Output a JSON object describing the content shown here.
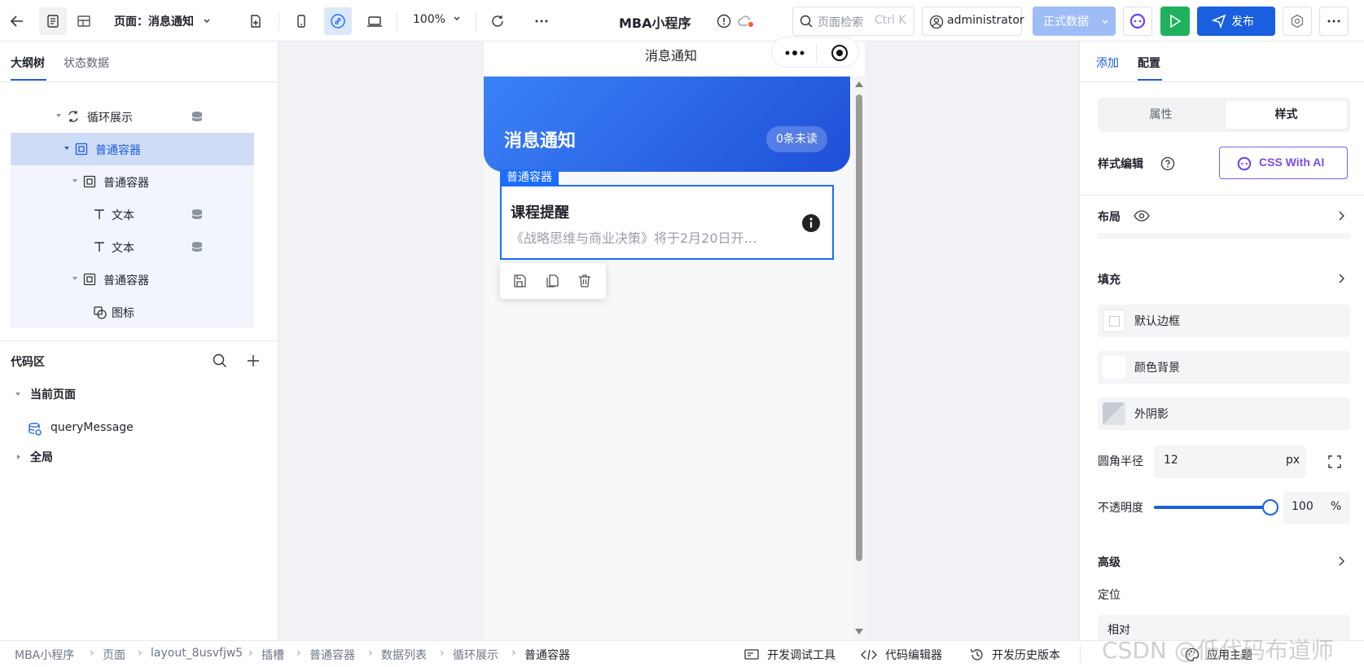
{
  "topbar": {
    "page_label": "页面：消息通知",
    "zoom": "100%",
    "app_title": "MBA小程序",
    "search_placeholder": "页面检索",
    "search_shortcut": "Ctrl K",
    "user": "administrator",
    "data_env": "正式数据",
    "publish": "发布"
  },
  "left": {
    "tabs": [
      "大纲树",
      "状态数据"
    ],
    "tree": [
      {
        "label": "循环展示",
        "icon": "loop-icon"
      },
      {
        "label": "普通容器",
        "icon": "container-icon"
      },
      {
        "label": "普通容器",
        "icon": "container-icon"
      },
      {
        "label": "文本",
        "icon": "text-icon"
      },
      {
        "label": "文本",
        "icon": "text-icon"
      },
      {
        "label": "普通容器",
        "icon": "container-icon"
      },
      {
        "label": "图标",
        "icon": "shapes-icon"
      }
    ],
    "code_title": "代码区",
    "code_current": "当前页面",
    "code_query": "queryMessage",
    "code_global": "全局"
  },
  "phone": {
    "nav_title": "消息通知",
    "header_title": "消息通知",
    "unread_badge": "0条未读",
    "selected_tag": "普通容器",
    "card_title": "课程提醒",
    "card_desc": "《战略思维与商业决策》将于2月20日开…",
    "colors": {
      "gradient_start": "#3b82f6",
      "gradient_end": "#1e4fd8",
      "selection": "#1a6dff"
    }
  },
  "right": {
    "tabs": [
      "添加",
      "配置"
    ],
    "segments": [
      "属性",
      "样式"
    ],
    "style_edit": "样式编辑",
    "css_ai": "CSS With AI",
    "layout": "布局",
    "fill": "填充",
    "border": "默认边框",
    "bg": "颜色背景",
    "shadow": "外阴影",
    "radius_label": "圆角半径",
    "radius_value": "12",
    "radius_unit": "px",
    "opacity_label": "不透明度",
    "opacity_value": "100",
    "opacity_unit": "%",
    "opacity_fraction": 1.0,
    "advanced": "高级",
    "position": "定位",
    "position_value": "相对"
  },
  "footer": {
    "breadcrumb": [
      "MBA小程序",
      "页面",
      "layout_8usvfjw5",
      "插槽",
      "普通容器",
      "数据列表",
      "循环展示",
      "普通容器"
    ],
    "devtools": "开发调试工具",
    "code_editor": "代码编辑器",
    "history": "开发历史版本",
    "theme": "应用主题",
    "watermark": "CSDN @低代码布道师"
  }
}
